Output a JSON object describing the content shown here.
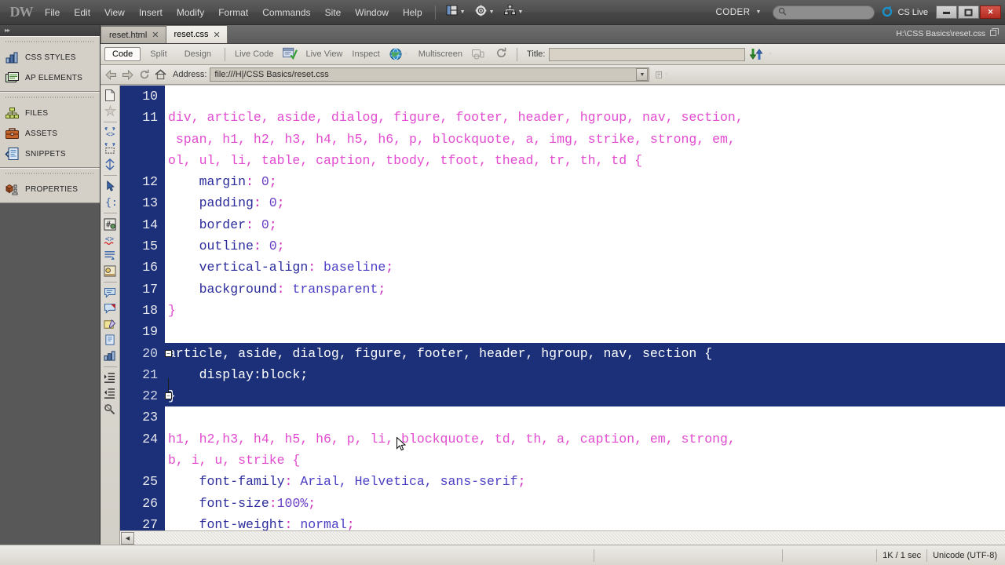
{
  "app": {
    "logo": "DW",
    "workspace": "CODER",
    "cs_live": "CS Live"
  },
  "menu": {
    "items": [
      "File",
      "Edit",
      "View",
      "Insert",
      "Modify",
      "Format",
      "Commands",
      "Site",
      "Window",
      "Help"
    ],
    "tool_dropdowns": [
      "layout-icon",
      "gear-icon",
      "site-icon"
    ]
  },
  "search": {
    "placeholder": "",
    "value": ""
  },
  "window_controls": {
    "minimize": "–",
    "maximize": "□",
    "close": "✕"
  },
  "tabs": {
    "items": [
      {
        "label": "reset.html",
        "close": "✕",
        "active": false
      },
      {
        "label": "reset.css",
        "close": "✕",
        "active": true
      }
    ],
    "filepath": "H:\\CSS Basics\\reset.css"
  },
  "viewbar": {
    "code": "Code",
    "split": "Split",
    "design": "Design",
    "live_code": "Live Code",
    "live_view": "Live View",
    "inspect": "Inspect",
    "multiscreen": "Multiscreen",
    "title_label": "Title:",
    "title_value": "",
    "title_placeholder": ""
  },
  "addressbar": {
    "label": "Address:",
    "value": "file:///H|/CSS Basics/reset.css",
    "back": "⇦",
    "forward": "⇨",
    "refresh": "↻",
    "home": "home-icon"
  },
  "dock": {
    "groups": [
      {
        "items": [
          {
            "label": "CSS STYLES",
            "icon": "css-styles-icon"
          },
          {
            "label": "AP ELEMENTS",
            "icon": "ap-elements-icon"
          }
        ]
      },
      {
        "items": [
          {
            "label": "FILES",
            "icon": "files-icon"
          },
          {
            "label": "ASSETS",
            "icon": "assets-icon"
          },
          {
            "label": "SNIPPETS",
            "icon": "snippets-icon"
          }
        ]
      },
      {
        "items": [
          {
            "label": "PROPERTIES",
            "icon": "properties-icon"
          }
        ]
      }
    ]
  },
  "coding_toolbar": {
    "icons": [
      "open-documents-icon",
      "show-code-navigator-icon",
      "collapse-full-tag-icon",
      "collapse-outside-selection-icon",
      "expand-all-icon",
      "select-parent-tag-icon",
      "balance-braces-icon",
      "line-numbers-icon",
      "highlight-invalid-code-icon",
      "word-wrap-icon",
      "syntax-coloring-icon",
      "apply-comment-icon",
      "remove-comment-icon",
      "wrap-tag-icon",
      "recent-snippets-icon",
      "move-css-rules-icon",
      "indent-code-icon",
      "outdent-code-icon",
      "format-source-code-icon"
    ]
  },
  "code": {
    "language": "css",
    "lines": [
      {
        "num": "10",
        "selected": false,
        "segments": []
      },
      {
        "num": "11",
        "selected": false,
        "segments": [
          {
            "cls": "sel-tag",
            "text": "div, article, aside, dialog, figure, footer, header, hgroup, nav, section,"
          }
        ]
      },
      {
        "num": "",
        "selected": false,
        "segments": [
          {
            "cls": "sel-tag",
            "text": " span, h1, h2, h3, h4, h5, h6, p, blockquote, a, img, strike, strong, em,"
          }
        ]
      },
      {
        "num": "",
        "selected": false,
        "segments": [
          {
            "cls": "sel-tag",
            "text": "ol, ul, li, table, caption, tbody, tfoot, thead, tr, th, td {"
          }
        ]
      },
      {
        "num": "12",
        "selected": false,
        "segments": [
          {
            "cls": "prop",
            "text": "    margin"
          },
          {
            "cls": "punct",
            "text": ":"
          },
          {
            "cls": "num",
            "text": " 0"
          },
          {
            "cls": "punct",
            "text": ";"
          }
        ]
      },
      {
        "num": "13",
        "selected": false,
        "segments": [
          {
            "cls": "prop",
            "text": "    padding"
          },
          {
            "cls": "punct",
            "text": ":"
          },
          {
            "cls": "num",
            "text": " 0"
          },
          {
            "cls": "punct",
            "text": ";"
          }
        ]
      },
      {
        "num": "14",
        "selected": false,
        "segments": [
          {
            "cls": "prop",
            "text": "    border"
          },
          {
            "cls": "punct",
            "text": ":"
          },
          {
            "cls": "num",
            "text": " 0"
          },
          {
            "cls": "punct",
            "text": ";"
          }
        ]
      },
      {
        "num": "15",
        "selected": false,
        "segments": [
          {
            "cls": "prop",
            "text": "    outline"
          },
          {
            "cls": "punct",
            "text": ":"
          },
          {
            "cls": "num",
            "text": " 0"
          },
          {
            "cls": "punct",
            "text": ";"
          }
        ]
      },
      {
        "num": "16",
        "selected": false,
        "segments": [
          {
            "cls": "prop",
            "text": "    vertical-align"
          },
          {
            "cls": "punct",
            "text": ":"
          },
          {
            "cls": "val",
            "text": " baseline"
          },
          {
            "cls": "punct",
            "text": ";"
          }
        ]
      },
      {
        "num": "17",
        "selected": false,
        "segments": [
          {
            "cls": "prop",
            "text": "    background"
          },
          {
            "cls": "punct",
            "text": ":"
          },
          {
            "cls": "val",
            "text": " transparent"
          },
          {
            "cls": "punct",
            "text": ";"
          }
        ]
      },
      {
        "num": "18",
        "selected": false,
        "segments": [
          {
            "cls": "sel-tag",
            "text": "}"
          }
        ]
      },
      {
        "num": "19",
        "selected": false,
        "segments": []
      },
      {
        "num": "20",
        "selected": true,
        "fold": "−",
        "segments": [
          {
            "cls": "",
            "text": "article, aside, dialog, figure, footer, header, hgroup, nav, section {"
          }
        ]
      },
      {
        "num": "21",
        "selected": true,
        "foldline": true,
        "segments": [
          {
            "cls": "",
            "text": "    display:block;"
          }
        ]
      },
      {
        "num": "22",
        "selected": true,
        "fold": "−",
        "segments": [
          {
            "cls": "",
            "text": "}"
          }
        ]
      },
      {
        "num": "23",
        "selected": false,
        "segments": []
      },
      {
        "num": "24",
        "selected": false,
        "segments": [
          {
            "cls": "sel-tag",
            "text": "h1, h2,h3, h4, h5, h6, p, li, blockquote, td, th, a, caption, em, strong,"
          }
        ]
      },
      {
        "num": "",
        "selected": false,
        "segments": [
          {
            "cls": "sel-tag",
            "text": "b, i, u, strike {"
          }
        ]
      },
      {
        "num": "25",
        "selected": false,
        "segments": [
          {
            "cls": "prop",
            "text": "    font-family"
          },
          {
            "cls": "punct",
            "text": ":"
          },
          {
            "cls": "val",
            "text": " Arial, Helvetica, sans-serif"
          },
          {
            "cls": "punct",
            "text": ";"
          }
        ]
      },
      {
        "num": "26",
        "selected": false,
        "segments": [
          {
            "cls": "prop",
            "text": "    font-size"
          },
          {
            "cls": "punct",
            "text": ":"
          },
          {
            "cls": "num",
            "text": "100%"
          },
          {
            "cls": "punct",
            "text": ";"
          }
        ]
      },
      {
        "num": "27",
        "selected": false,
        "segments": [
          {
            "cls": "prop",
            "text": "    font-weight"
          },
          {
            "cls": "punct",
            "text": ":"
          },
          {
            "cls": "val",
            "text": " normal"
          },
          {
            "cls": "punct",
            "text": ";"
          }
        ]
      }
    ]
  },
  "statusbar": {
    "size_time": "1K / 1 sec",
    "encoding": "Unicode (UTF-8)"
  },
  "colors": {
    "selection_bg": "#1b3078",
    "selector": "#e24bd0",
    "property": "#2b2b9c",
    "punctuation": "#cc2fbb",
    "value": "#4b3fc4",
    "close_button": "#b32b20",
    "chrome": "#4f4f4f"
  }
}
